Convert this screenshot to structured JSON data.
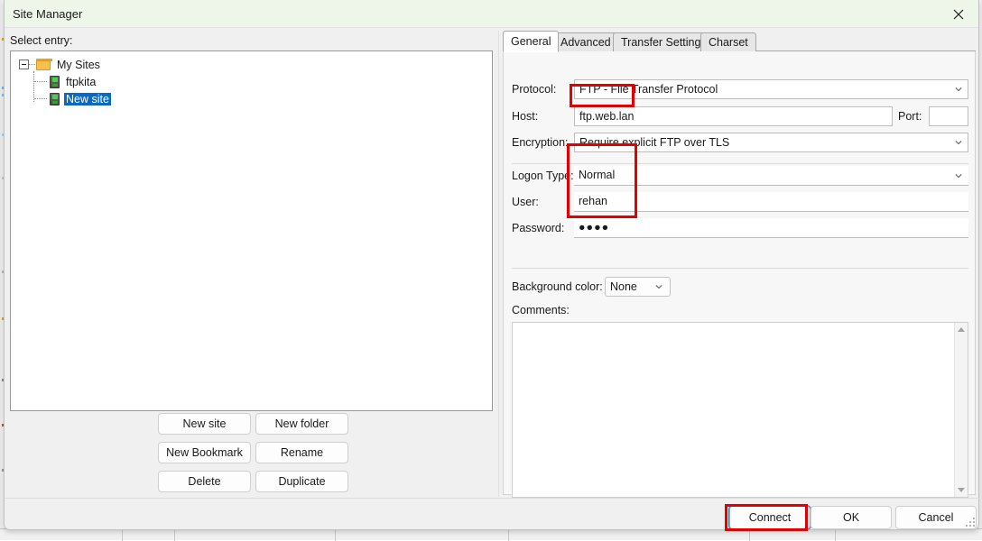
{
  "window": {
    "title": "Site Manager",
    "close_icon": "close-icon"
  },
  "left": {
    "select_entry_label": "Select entry:",
    "tree": {
      "root": {
        "label": "My Sites",
        "icon": "folder-icon",
        "expanded": true
      },
      "children": [
        {
          "label": "ftpkita",
          "icon": "server-icon",
          "selected": false
        },
        {
          "label": "New site",
          "icon": "server-icon",
          "selected": true
        }
      ]
    },
    "buttons": [
      "New site",
      "New folder",
      "New Bookmark",
      "Rename",
      "Delete",
      "Duplicate"
    ]
  },
  "right": {
    "tabs": [
      {
        "label": "General",
        "active": true
      },
      {
        "label": "Advanced",
        "active": false
      },
      {
        "label": "Transfer Settings",
        "active": false
      },
      {
        "label": "Charset",
        "active": false
      }
    ],
    "fields": {
      "protocol_label": "Protocol:",
      "protocol_value": "FTP - File Transfer Protocol",
      "host_label": "Host:",
      "host_value": "ftp.web.lan",
      "port_label": "Port:",
      "port_value": "",
      "encryption_label": "Encryption:",
      "encryption_value": "Require explicit FTP over TLS",
      "logon_type_label": "Logon Type:",
      "logon_type_value": "Normal",
      "user_label": "User:",
      "user_value": "rehan",
      "password_label": "Password:",
      "password_value": "●●●●",
      "background_color_label": "Background color:",
      "background_color_value": "None",
      "comments_label": "Comments:",
      "comments_value": ""
    }
  },
  "bottom": {
    "connect": "Connect",
    "ok": "OK",
    "cancel": "Cancel"
  },
  "annotations": {
    "accent_red": "#e40000",
    "selection_blue": "#0a68c8",
    "highlights": [
      "host-field",
      "credentials-group",
      "connect-button"
    ]
  }
}
